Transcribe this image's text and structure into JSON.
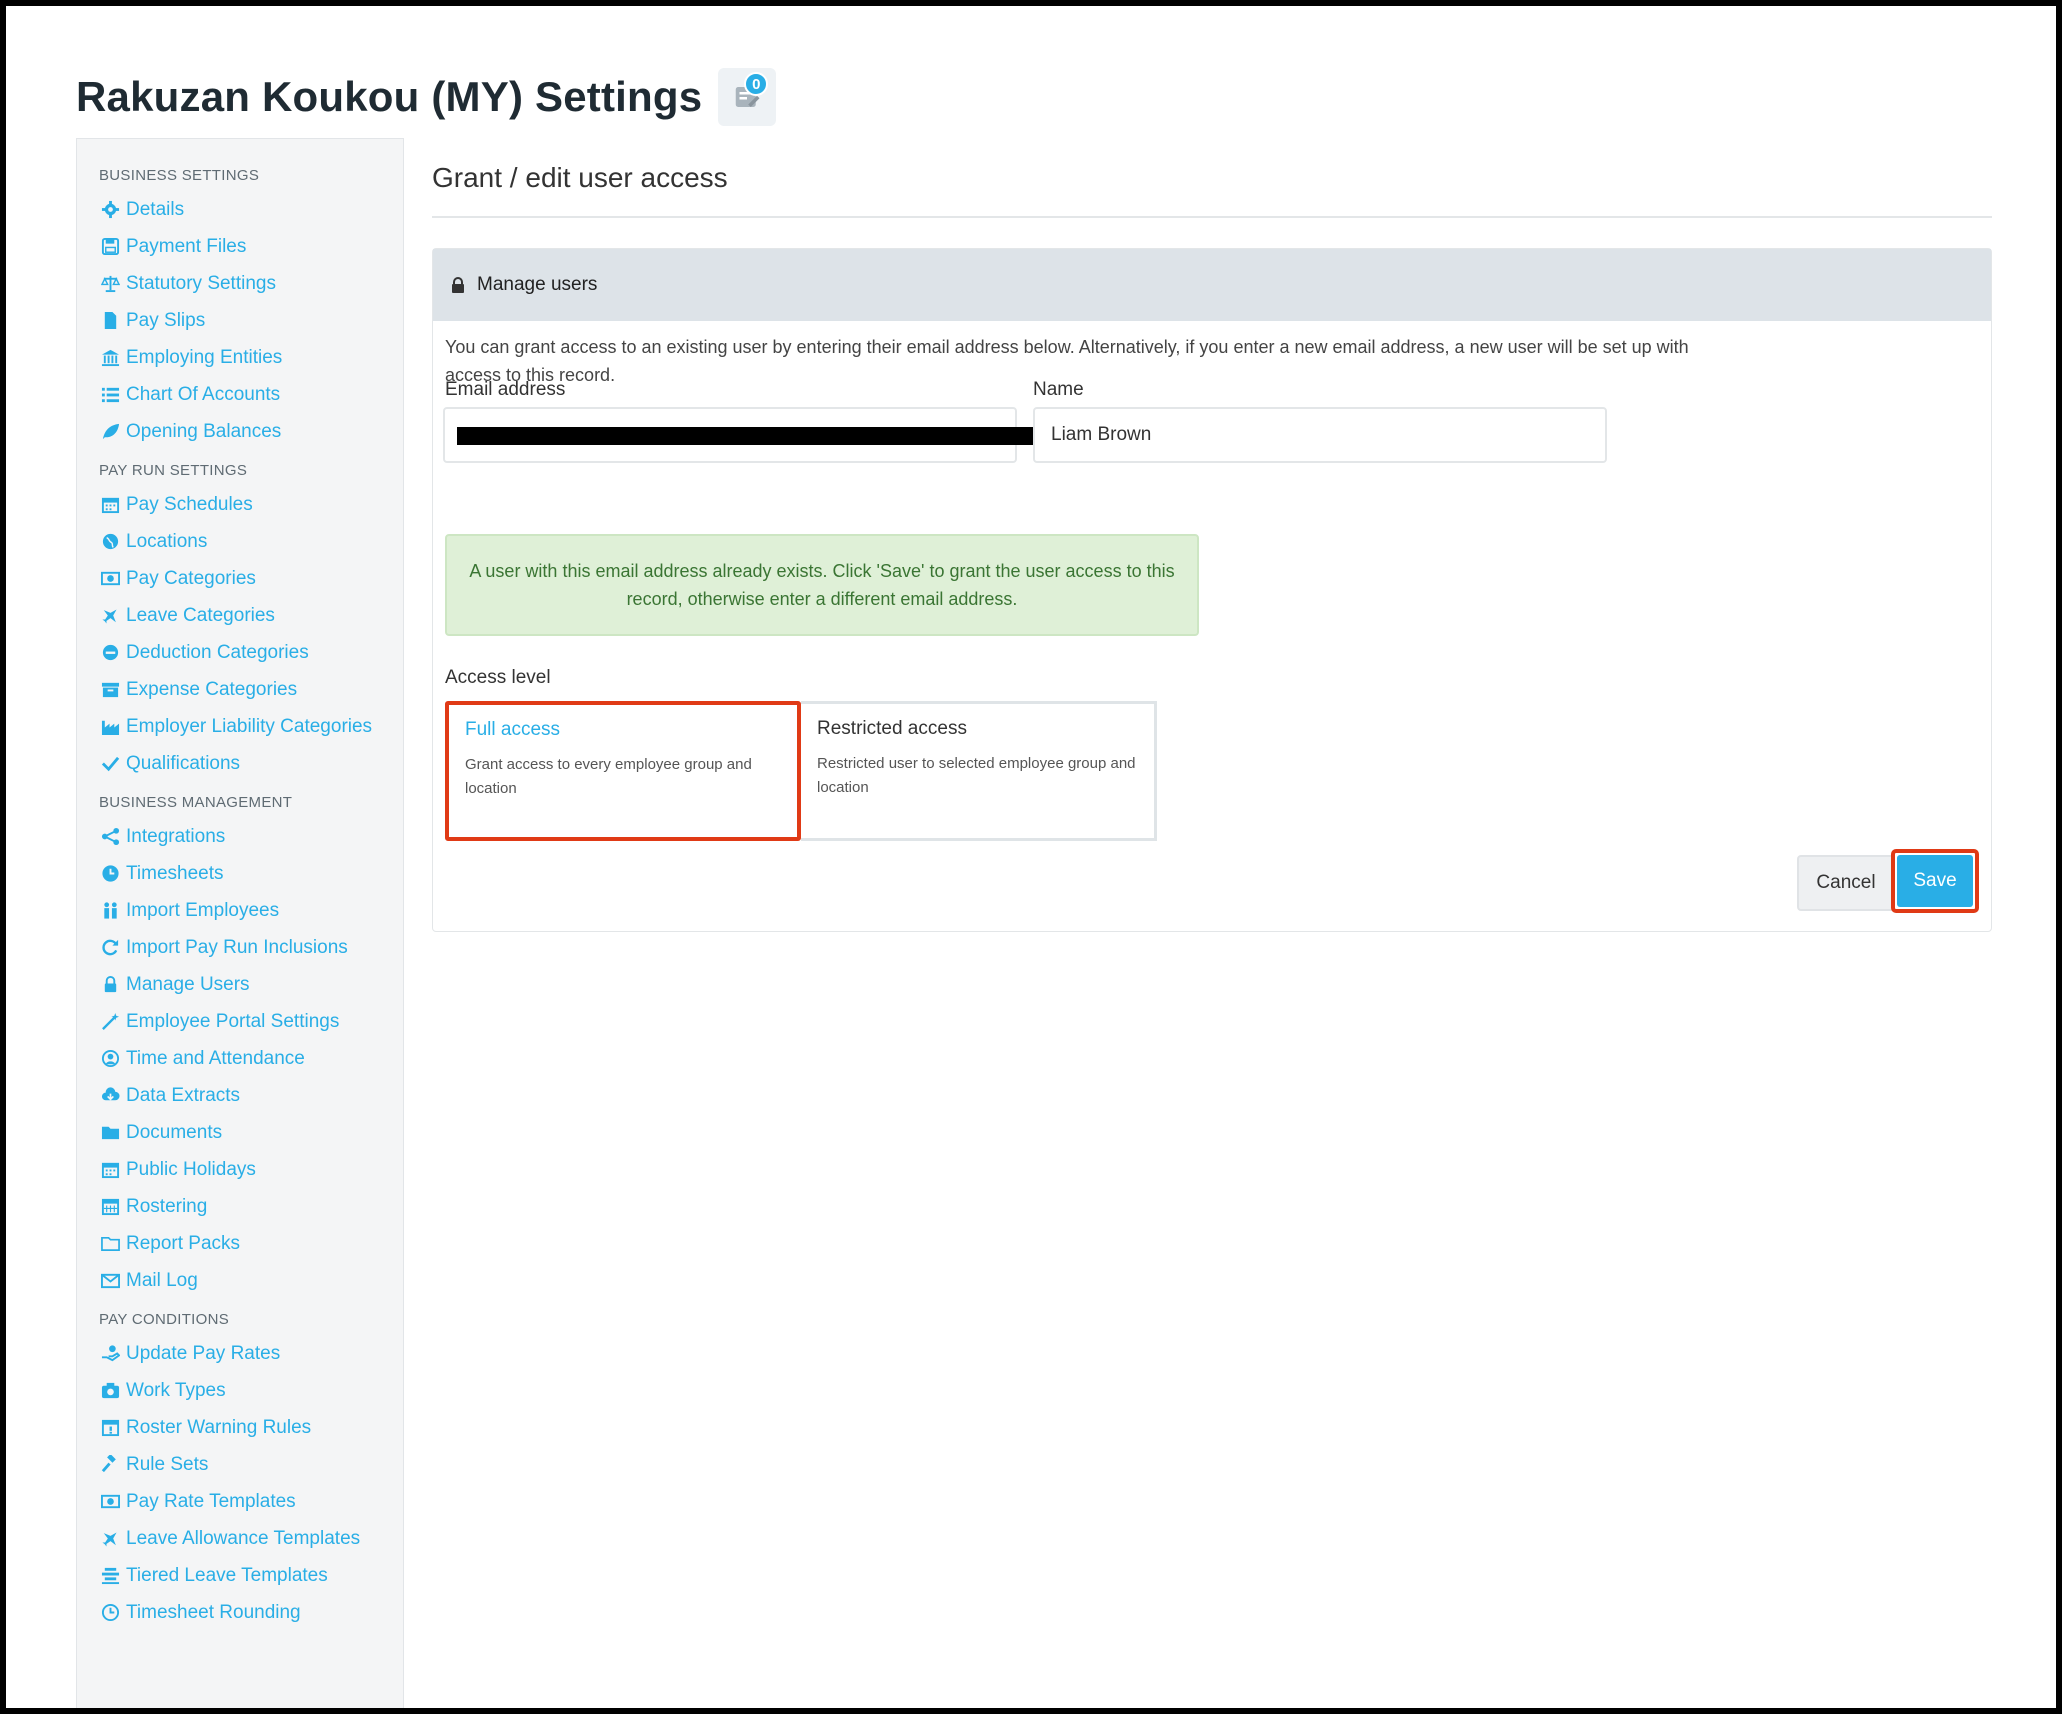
{
  "header": {
    "title": "Rakuzan Koukou (MY) Settings",
    "notification_count": "0"
  },
  "sidebar": {
    "sections": [
      {
        "title": "BUSINESS SETTINGS",
        "items": [
          {
            "label": "Details",
            "icon": "gear-icon"
          },
          {
            "label": "Payment Files",
            "icon": "floppy-icon"
          },
          {
            "label": "Statutory Settings",
            "icon": "scale-icon"
          },
          {
            "label": "Pay Slips",
            "icon": "file-icon"
          },
          {
            "label": "Employing Entities",
            "icon": "bank-icon"
          },
          {
            "label": "Chart Of Accounts",
            "icon": "list-icon"
          },
          {
            "label": "Opening Balances",
            "icon": "leaf-icon"
          }
        ]
      },
      {
        "title": "PAY RUN SETTINGS",
        "items": [
          {
            "label": "Pay Schedules",
            "icon": "calendar-icon"
          },
          {
            "label": "Locations",
            "icon": "globe-icon"
          },
          {
            "label": "Pay Categories",
            "icon": "money-icon"
          },
          {
            "label": "Leave Categories",
            "icon": "plane-icon"
          },
          {
            "label": "Deduction Categories",
            "icon": "minus-circle-icon"
          },
          {
            "label": "Expense Categories",
            "icon": "archive-icon"
          },
          {
            "label": "Employer Liability Categories",
            "icon": "industry-icon"
          },
          {
            "label": "Qualifications",
            "icon": "check-icon"
          }
        ]
      },
      {
        "title": "BUSINESS MANAGEMENT",
        "items": [
          {
            "label": "Integrations",
            "icon": "share-icon"
          },
          {
            "label": "Timesheets",
            "icon": "clock-icon"
          },
          {
            "label": "Import Employees",
            "icon": "users-icon"
          },
          {
            "label": "Import Pay Run Inclusions",
            "icon": "refresh-icon"
          },
          {
            "label": "Manage Users",
            "icon": "lock-icon"
          },
          {
            "label": "Employee Portal Settings",
            "icon": "wand-icon"
          },
          {
            "label": "Time and Attendance",
            "icon": "user-clock-icon"
          },
          {
            "label": "Data Extracts",
            "icon": "cloud-download-icon"
          },
          {
            "label": "Documents",
            "icon": "folder-icon"
          },
          {
            "label": "Public Holidays",
            "icon": "calendar-icon"
          },
          {
            "label": "Rostering",
            "icon": "calendar-grid-icon"
          },
          {
            "label": "Report Packs",
            "icon": "folder-open-icon"
          },
          {
            "label": "Mail Log",
            "icon": "envelope-icon"
          }
        ]
      },
      {
        "title": "PAY CONDITIONS",
        "items": [
          {
            "label": "Update Pay Rates",
            "icon": "hand-money-icon"
          },
          {
            "label": "Work Types",
            "icon": "camera-icon"
          },
          {
            "label": "Roster Warning Rules",
            "icon": "calendar-alert-icon"
          },
          {
            "label": "Rule Sets",
            "icon": "gavel-icon"
          },
          {
            "label": "Pay Rate Templates",
            "icon": "money-icon"
          },
          {
            "label": "Leave Allowance Templates",
            "icon": "plane-icon"
          },
          {
            "label": "Tiered Leave Templates",
            "icon": "stack-icon"
          },
          {
            "label": "Timesheet Rounding",
            "icon": "clock-outline-icon"
          }
        ]
      }
    ]
  },
  "main": {
    "title": "Grant / edit user access",
    "panel": {
      "header": "Manage users",
      "intro": "You can grant access to an existing user by entering their email address below. Alternatively, if you enter a new email address, a new user will be set up with access to this record.",
      "email_label": "Email address",
      "name_label": "Name",
      "name_value": "Liam Brown",
      "alert": "A user with this email address already exists. Click 'Save' to grant the user access to this record, otherwise enter a different email address.",
      "access_level_label": "Access level",
      "full_access": {
        "title": "Full access",
        "desc": "Grant access to every employee group and location"
      },
      "restricted_access": {
        "title": "Restricted access",
        "desc": "Restricted user to selected employee group and location"
      },
      "cancel_label": "Cancel",
      "save_label": "Save"
    }
  },
  "colors": {
    "accent": "#29aee6",
    "highlight": "#e03a16",
    "alert_bg": "#dff0d7",
    "alert_text": "#3a7533"
  }
}
